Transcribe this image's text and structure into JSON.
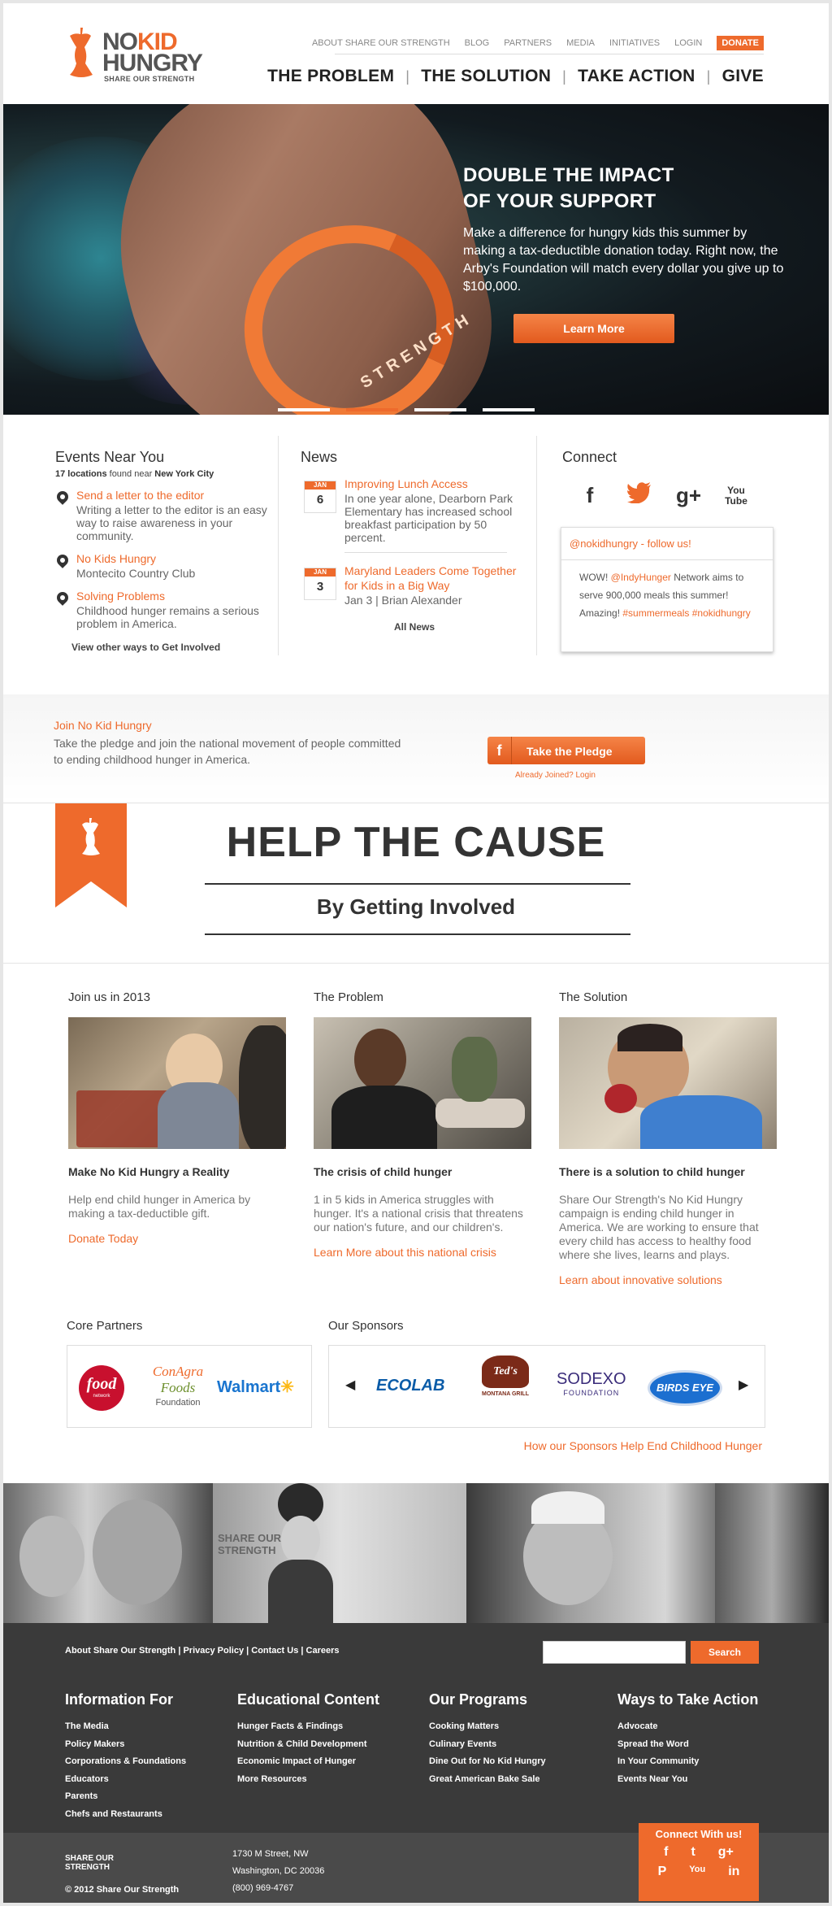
{
  "header": {
    "logo": {
      "line1a": "NO",
      "line1b": "KID",
      "line2": "HUNGRY",
      "tag": "SHARE OUR STRENGTH"
    },
    "topnav": [
      "ABOUT SHARE OUR STRENGTH",
      "BLOG",
      "PARTNERS",
      "MEDIA",
      "INITIATIVES",
      "LOGIN"
    ],
    "donate": "DONATE",
    "mainnav": [
      "THE PROBLEM",
      "THE SOLUTION",
      "TAKE ACTION",
      "GIVE"
    ]
  },
  "hero": {
    "title_l1": "DOUBLE THE IMPACT",
    "title_l2": "OF YOUR SUPPORT",
    "body": "Make a difference for hungry kids this summer by making a tax-deductible donation today. Right now, the Arby's Foundation will match every dollar you give up to $100,000.",
    "button": "Learn More",
    "band_text": "STRENGTH",
    "slides": 4,
    "active_slide": 2
  },
  "events": {
    "title": "Events Near You",
    "count": "17 locations",
    "found": " found near ",
    "city": "New York City",
    "items": [
      {
        "title": "Send a letter to the editor",
        "desc": "Writing a letter to the editor is an easy way to raise awareness in your community."
      },
      {
        "title": "No Kids Hungry",
        "desc": "Montecito Country Club"
      },
      {
        "title": "Solving Problems",
        "desc": "Childhood hunger remains a serious problem in America."
      }
    ],
    "more": "View other ways to Get Involved"
  },
  "news": {
    "title": "News",
    "items": [
      {
        "month": "JAN",
        "day": "6",
        "title": "Improving Lunch Access",
        "desc": "In one year alone, Dearborn Park Elementary has increased school breakfast participation by 50 percent."
      },
      {
        "month": "JAN",
        "day": "3",
        "title": "Maryland Leaders Come Together for Kids in a Big Way",
        "desc": "Jan 3 | Brian Alexander"
      }
    ],
    "all": "All News"
  },
  "connect": {
    "title": "Connect",
    "icons": [
      "f",
      "t",
      "g+",
      "You Tube"
    ],
    "handle": "@nokidhungry - follow us!",
    "tweet_pre": "WOW! ",
    "tweet_mention": "@IndyHunger",
    "tweet_mid": " Network aims to serve 900,000 meals this summer! Amazing! ",
    "tweet_tag1": "#summermeals",
    "tweet_tag2": "#nokidhungry"
  },
  "pledge": {
    "title": "Join No Kid Hungry",
    "desc": "Take the pledge and join the national movement of people committed to ending childhood hunger in America.",
    "fb": "f",
    "button": "Take the Pledge",
    "already": "Already Joined? Login"
  },
  "cause": {
    "title": "HELP THE CAUSE",
    "subtitle": "By Getting Involved"
  },
  "involve": [
    {
      "heading": "Join us in 2013",
      "caption": "Make No Kid Hungry a Reality",
      "desc": "Help end child hunger in America by making a tax-deductible gift.",
      "link": "Donate Today"
    },
    {
      "heading": "The Problem",
      "caption": "The crisis of child hunger",
      "desc": "1 in 5 kids in America struggles with hunger. It's a national crisis that threatens our nation's future, and our children's.",
      "link": "Learn More about this national crisis"
    },
    {
      "heading": "The Solution",
      "caption": "There is a solution to child hunger",
      "desc": "Share Our Strength's No Kid Hungry campaign is ending child hunger in America. We are working to ensure that every child has access to healthy food where she lives, learns and plays.",
      "link": "Learn about innovative solutions"
    }
  ],
  "partners": {
    "core_title": "Core Partners",
    "core": [
      "food",
      "network",
      "ConAgra",
      "Foods",
      "Foundation",
      "Walmart"
    ],
    "sponsors_title": "Our Sponsors",
    "sponsors": [
      "ECOLAB",
      "Ted's",
      "MONTANA GRILL",
      "SODEXO",
      "FOUNDATION",
      "BIRDS EYE"
    ],
    "link": "How our Sponsors Help End Childhood Hunger"
  },
  "strip": {
    "sign": "SHARE OUR STRENGTH"
  },
  "footer": {
    "links": "About Share Our Strength | Privacy Policy | Contact Us | Careers",
    "search_btn": "Search",
    "cols": [
      {
        "title": "Information For",
        "items": [
          "The Media",
          "Policy Makers",
          "Corporations & Foundations",
          "Educators",
          "Parents",
          "Chefs and Restaurants"
        ]
      },
      {
        "title": "Educational Content",
        "items": [
          "Hunger Facts & Findings",
          "Nutrition & Child Development",
          "Economic Impact of Hunger",
          "More Resources"
        ]
      },
      {
        "title": "Our Programs",
        "items": [
          "Cooking Matters",
          "Culinary Events",
          "Dine Out for No Kid Hungry",
          "Great American Bake Sale"
        ]
      },
      {
        "title": "Ways to Take Action",
        "items": [
          "Advocate",
          "Spread the Word",
          "In Your Community",
          "Events Near You"
        ]
      }
    ],
    "logo1": "SHARE OUR",
    "logo2": "STRENGTH",
    "copyright": "© 2012 Share Our Strength",
    "address": [
      "1730 M Street, NW",
      "Washington, DC 20036",
      "(800) 969-4767"
    ],
    "connect_title": "Connect With us!",
    "connect_icons": [
      "f",
      "t",
      "g+",
      "P",
      "You",
      "in"
    ]
  },
  "colors": {
    "accent": "#ee6a2c",
    "dark": "#3a3a3a"
  }
}
